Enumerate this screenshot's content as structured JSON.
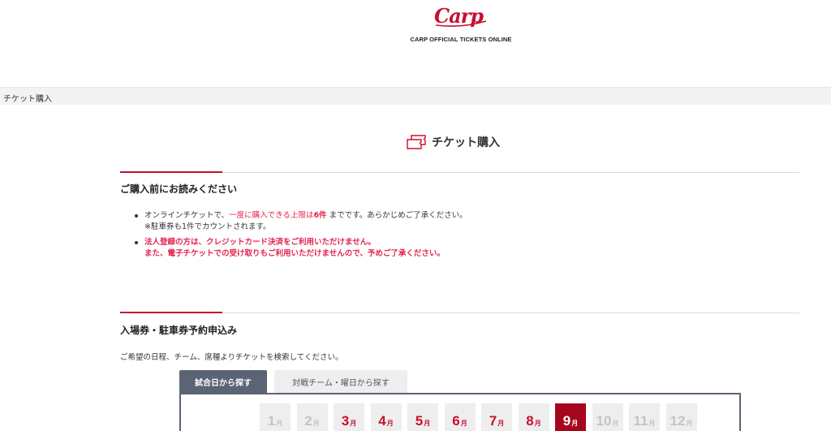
{
  "header": {
    "logo_text": "Carp",
    "subtitle": "CARP OFFICIAL TICKETS ONLINE"
  },
  "breadcrumb": {
    "current": "チケット購入"
  },
  "page": {
    "title": "チケット購入",
    "title_icon": "ticket-icon",
    "accent_color": "#c8102e"
  },
  "notice_section": {
    "heading": "ご購入前にお読みください",
    "item1": {
      "pre": "オンラインチケットで、",
      "highlight": "一度に購入できる上限は",
      "limit": "6件",
      "post": " までです。あらかじめご了承ください。",
      "note": "※駐車券も1件でカウントされます。"
    },
    "item2": {
      "line1": "法人登録の方は、クレジットカード決済をご利用いただけません。",
      "line2": "また、電子チケットでの受け取りもご利用いただけませんので、予めご了承ください。"
    }
  },
  "reservation_section": {
    "heading": "入場券・駐車券予約申込み",
    "lead": "ご希望の日程、チーム、席種よりチケットを検索してください。",
    "tabs": [
      {
        "label": "試合日から探す",
        "active": true
      },
      {
        "label": "対戦チーム・曜日から探す",
        "active": false
      }
    ],
    "month_unit": "月",
    "months": [
      {
        "num": "1",
        "state": "disabled"
      },
      {
        "num": "2",
        "state": "disabled"
      },
      {
        "num": "3",
        "state": "enabled"
      },
      {
        "num": "4",
        "state": "enabled"
      },
      {
        "num": "5",
        "state": "enabled"
      },
      {
        "num": "6",
        "state": "enabled"
      },
      {
        "num": "7",
        "state": "enabled"
      },
      {
        "num": "8",
        "state": "enabled"
      },
      {
        "num": "9",
        "state": "selected"
      },
      {
        "num": "10",
        "state": "disabled"
      },
      {
        "num": "11",
        "state": "disabled"
      },
      {
        "num": "12",
        "state": "disabled"
      }
    ]
  }
}
